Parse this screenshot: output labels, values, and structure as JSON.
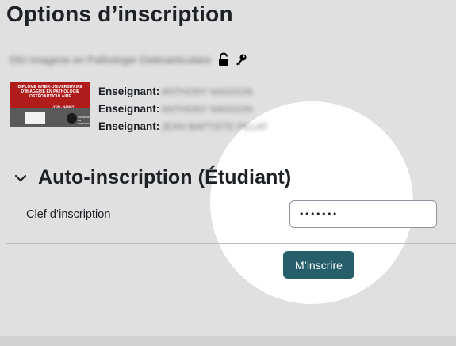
{
  "page": {
    "title": "Options d’inscription"
  },
  "course": {
    "name": "DIU Imagerie en Pathologie Ostéoarticulaire",
    "icons": [
      "unlock-icon",
      "key-icon"
    ],
    "image": {
      "banner_text": "DIPLÔME INTER-UNIVERSITAIRE D'IMAGERIE EN PATHOLOGIE OSTÉOARTICULAIRE",
      "city_text": "LYON - NANCY",
      "logo1_text": "Lyon 1",
      "logo2_text": "UNIVERSITÉ DE LORRAINE"
    },
    "teachers": [
      {
        "role": "Enseignant:",
        "name": "ANTHONY NAGGON"
      },
      {
        "role": "Enseignant:",
        "name": "ANTHONY NAGGON"
      },
      {
        "role": "Enseignant:",
        "name": "JEAN BAPTISTE PILLAT"
      }
    ]
  },
  "enrolment": {
    "section_title": "Auto-inscription (Étudiant)",
    "key_label": "Clef d’inscription",
    "key_value": "•••••••",
    "submit_label": "M’inscrire"
  },
  "colors": {
    "background": "#e0e0e0",
    "spotlight": "#ffffff",
    "button": "#265e6b",
    "text": "#1d2125"
  }
}
